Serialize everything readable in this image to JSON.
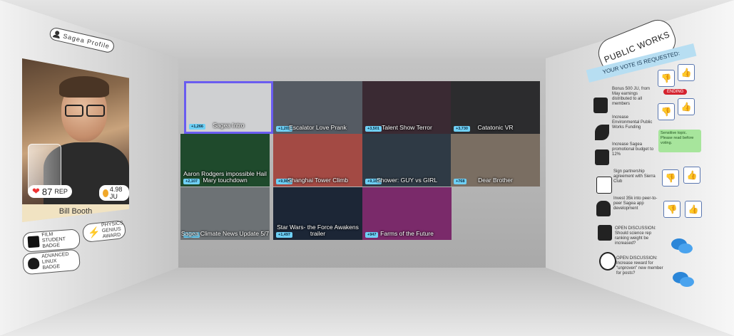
{
  "profile": {
    "tag_label": "Sagea Profile",
    "name": "Bill Booth",
    "rep_value": "87",
    "rep_unit": "REP",
    "ju_value": "4.98 JU",
    "badges": [
      {
        "label": "FILM STUDENT BADGE",
        "icon": "camera-icon"
      },
      {
        "label": "PHYSICS GENIUS AWARD",
        "icon": "lightning-icon"
      },
      {
        "label": "ADVANCED LINUX BADGE",
        "icon": "penguin-icon"
      }
    ]
  },
  "videos": [
    {
      "title": "Sagea Intro",
      "count": "+1,266",
      "bg": "#cfd0d2",
      "selected": true
    },
    {
      "title": "Escalator Love Prank",
      "count": "+1,201",
      "bg": "#555b63"
    },
    {
      "title": "Talent Show Terror",
      "count": "+3,501",
      "bg": "#3a2a33"
    },
    {
      "title": "Catatonic VR",
      "count": "+3,730",
      "bg": "#2c2c2e"
    },
    {
      "title": "Aaron Rodgers impossible Hail Mary touchdown",
      "count": "+2,107",
      "bg": "#1f4a2c"
    },
    {
      "title": "Shanghai Tower Climb",
      "count": "+9,908",
      "bg": "#a34a44"
    },
    {
      "title": "Shower: GUY vs GIRL",
      "count": "+9,103",
      "bg": "#2f3a45"
    },
    {
      "title": "Dear Brother",
      "count": "+768",
      "bg": "#7a6e62"
    },
    {
      "title": "Sagea Climate News Update 5/7",
      "count": "+1,300",
      "bg": "#6d7275"
    },
    {
      "title": "Star Wars- the Force Awakens trailer",
      "count": "+1,497",
      "bg": "#1c2636"
    },
    {
      "title": "Farms of the Future",
      "count": "+947",
      "bg": "#7a2a6a"
    }
  ],
  "public_works": {
    "title": "PUBLIC WORKS",
    "vote_banner": "YOUR VOTE IS REQUESTED:",
    "ending_label": "ENDING",
    "sensitive_note": "Sensitive topic. Please read before voting.",
    "items": [
      {
        "text": "Bonus 500 JU, from May earnings distributed to all members",
        "icon": "person-icon"
      },
      {
        "text": "Increase Environmental Public Works Funding",
        "icon": "leaf-icon"
      },
      {
        "text": "Increase Sagea promotional budget to 12%",
        "icon": "bank-icon"
      },
      {
        "text": "Sign partnership agreement with Sierra Club",
        "icon": "document-icon"
      },
      {
        "text": "Invest 35k into peer-to-peer Sagea app development",
        "icon": "android-icon"
      },
      {
        "text": "OPEN DISCUSSION: Should science rep ranking weight be increased?",
        "icon": "sliders-icon"
      },
      {
        "text": "OPEN DISCUSSION: Increase reward for \"unproven\" new member for posts?",
        "icon": "dollar-icon"
      }
    ]
  }
}
